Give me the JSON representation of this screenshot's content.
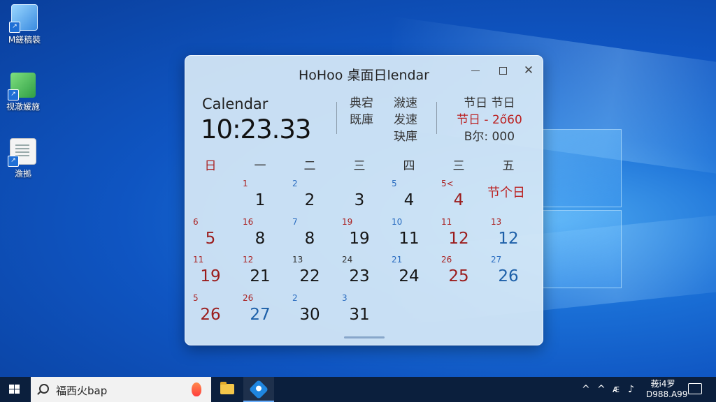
{
  "desktop": {
    "icons": [
      {
        "label": "M鎈稿裝"
      },
      {
        "label": "视澈媛施"
      },
      {
        "label": "澹拠"
      }
    ]
  },
  "window": {
    "title": "HoHoo 桌面日lendar",
    "min_icon": "minimize-icon",
    "max_icon": "maximize-icon",
    "close_symbol": "✕"
  },
  "header": {
    "label": "Calendar",
    "time": "10:23.33",
    "info_col1": [
      "典宕",
      "既庫"
    ],
    "info_col2": [
      "潊速",
      "发速",
      "玦庫"
    ],
    "info_col3_line1": "节日  节日",
    "info_col3_line2": "节日 - 2ő60",
    "info_col3_line3": "B尔: 000"
  },
  "calendar": {
    "weekdays": [
      "日",
      "一",
      "二",
      "三",
      "四",
      "三",
      "五"
    ],
    "holiday_text": "节个日",
    "rows": [
      [
        {
          "sub": "",
          "day": ""
        },
        {
          "sub": "1",
          "day": "1",
          "sub_color": "red",
          "day_color": "black"
        },
        {
          "sub": "2",
          "day": "2",
          "sub_color": "blue",
          "day_color": "black"
        },
        {
          "sub": "",
          "day": "3",
          "sub_color": "black",
          "day_color": "black"
        },
        {
          "sub": "5",
          "day": "4",
          "sub_color": "blue",
          "day_color": "black"
        },
        {
          "sub": "5<",
          "day": "4",
          "sub_color": "red",
          "day_color": "red"
        },
        {
          "sub": "",
          "day": ""
        }
      ],
      [
        {
          "sub": "6",
          "day": "5",
          "sub_color": "red",
          "day_color": "red"
        },
        {
          "sub": "16",
          "day": "8",
          "sub_color": "red",
          "day_color": "black"
        },
        {
          "sub": "7",
          "day": "8",
          "sub_color": "blue",
          "day_color": "black"
        },
        {
          "sub": "19",
          "day": "19",
          "sub_color": "red",
          "day_color": "black"
        },
        {
          "sub": "10",
          "day": "11",
          "sub_color": "blue",
          "day_color": "black"
        },
        {
          "sub": "11",
          "day": "12",
          "sub_color": "red",
          "day_color": "red"
        },
        {
          "sub": "13",
          "day": "12",
          "sub_color": "red",
          "day_color": "blue"
        }
      ],
      [
        {
          "sub": "11",
          "day": "19",
          "sub_color": "red",
          "day_color": "red"
        },
        {
          "sub": "12",
          "day": "21",
          "sub_color": "red",
          "day_color": "black"
        },
        {
          "sub": "13",
          "day": "22",
          "sub_color": "black",
          "day_color": "black"
        },
        {
          "sub": "24",
          "day": "23",
          "sub_color": "black",
          "day_color": "black"
        },
        {
          "sub": "21",
          "day": "24",
          "sub_color": "blue",
          "day_color": "black"
        },
        {
          "sub": "26",
          "day": "25",
          "sub_color": "red",
          "day_color": "red"
        },
        {
          "sub": "27",
          "day": "26",
          "sub_color": "blue",
          "day_color": "blue"
        }
      ],
      [
        {
          "sub": "5",
          "day": "26",
          "sub_color": "red",
          "day_color": "red"
        },
        {
          "sub": "26",
          "day": "27",
          "sub_color": "red",
          "day_color": "blue"
        },
        {
          "sub": "2",
          "day": "30",
          "sub_color": "blue",
          "day_color": "black"
        },
        {
          "sub": "3",
          "day": "31",
          "sub_color": "blue",
          "day_color": "black"
        },
        {
          "sub": "",
          "day": ""
        },
        {
          "sub": "",
          "day": ""
        },
        {
          "sub": "",
          "day": ""
        }
      ]
    ]
  },
  "taskbar": {
    "search_text": "福西火bap",
    "tray_symbols": [
      "^",
      "^",
      "ᴁ",
      "♪"
    ],
    "clock_line1": "莪i4罗",
    "clock_line2": "D988.A99"
  }
}
